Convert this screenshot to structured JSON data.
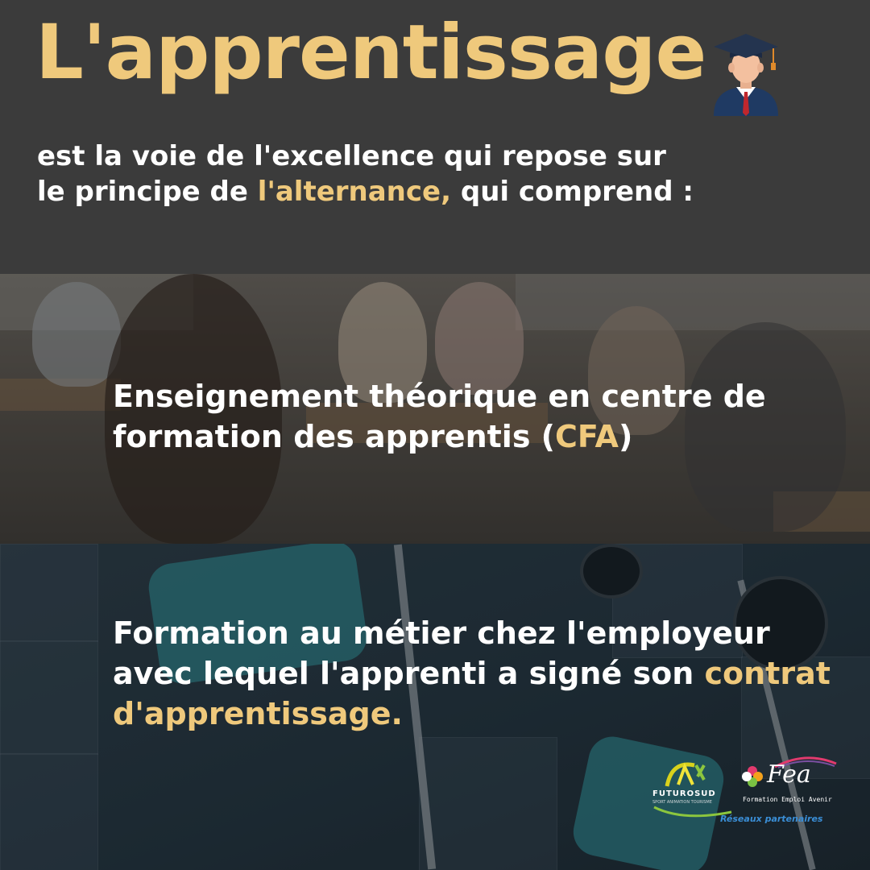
{
  "header": {
    "title": "L'apprentissage",
    "intro_line1": "est la voie de l'excellence qui repose sur",
    "intro_line2_before": "le principe de ",
    "intro_line2_accent": "l'alternance,",
    "intro_line2_after": " qui comprend :"
  },
  "blocks": [
    {
      "line1": "Enseignement théorique en centre de",
      "line2_before": "formation des apprentis (",
      "line2_accent": "CFA",
      "line2_after": ")"
    },
    {
      "line1": "Formation au métier chez l'employeur",
      "line2_before": "avec lequel l'apprenti a signé son ",
      "line2_accent": "contrat",
      "line3_accent": "d'apprentissage."
    }
  ],
  "logos": {
    "futurosud_name": "FUTUROSUD",
    "futurosud_tagline": "SPORT ANIMATION TOURISME",
    "fea_name": "Fea",
    "fea_tagline": "Formation Emploi Avenir",
    "partners_label": "Réseaux partenaires"
  },
  "colors": {
    "accent": "#efc97c",
    "header_bg": "#3b3b3b",
    "text": "#ffffff",
    "partners_blue": "#3a8ed6"
  },
  "icons": [
    "graduate-icon",
    "futurosud-logo",
    "fea-logo"
  ]
}
